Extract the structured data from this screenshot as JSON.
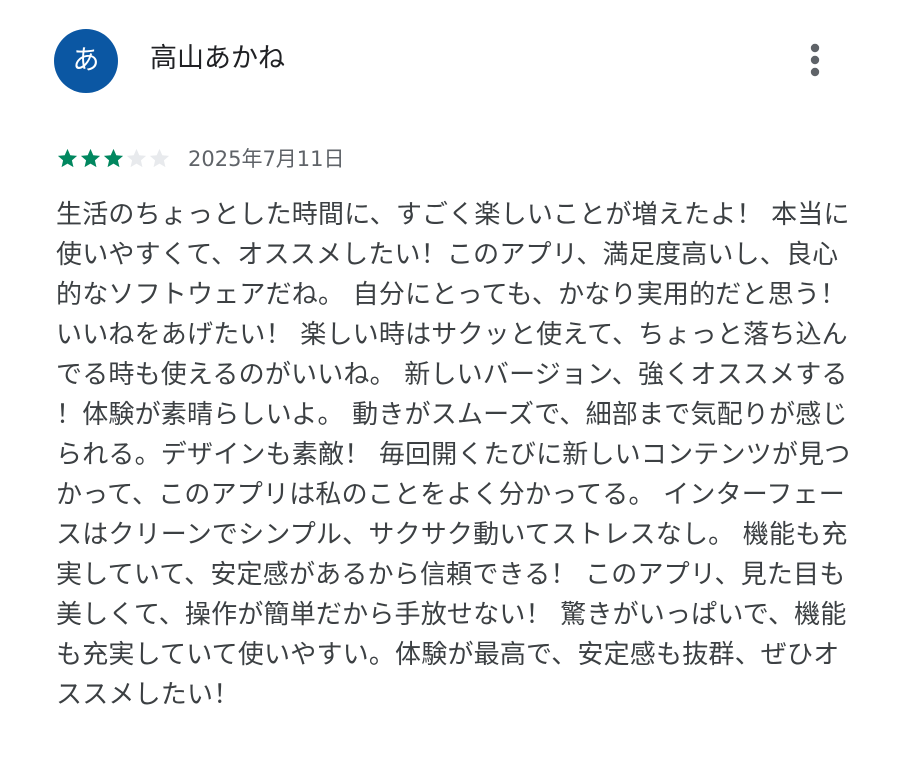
{
  "review": {
    "avatar_initial": "あ",
    "reviewer_name": "高山あかね",
    "more_icon": "more-vert-icon",
    "rating": 3,
    "rating_max": 5,
    "date": "2025年7月11日",
    "body": "生活のちょっとした時間に、すごく楽しいことが増えたよ！ 本当に使いやすくて、オススメしたい！このアプリ、満足度高いし、良心的なソフトウェアだね。 自分にとっても、かなり実用的だと思う！いいねをあげたい！ 楽しい時はサクッと使えて、ちょっと落ち込んでる時も使えるのがいいね。 新しいバージョン、強くオススメする！体験が素晴らしいよ。 動きがスムーズで、細部まで気配りが感じられる。デザインも素敵！ 毎回開くたびに新しいコンテンツが見つかって、このアプリは私のことをよく分かってる。 インターフェースはクリーンでシンプル、サクサク動いてストレスなし。 機能も充実していて、安定感があるから信頼できる！ このアプリ、見た目も美しくて、操作が簡単だから手放せない！ 驚きがいっぱいで、機能も充実していて使いやすい。体験が最高で、安定感も抜群、ぜひオススメしたい！"
  },
  "colors": {
    "avatar_bg": "#0b57a3",
    "star_filled": "#01875f",
    "star_empty": "#e8eaed",
    "name_text": "#202124",
    "date_text": "#5f6368",
    "body_text": "#3c4043",
    "icon": "#5f6368"
  }
}
